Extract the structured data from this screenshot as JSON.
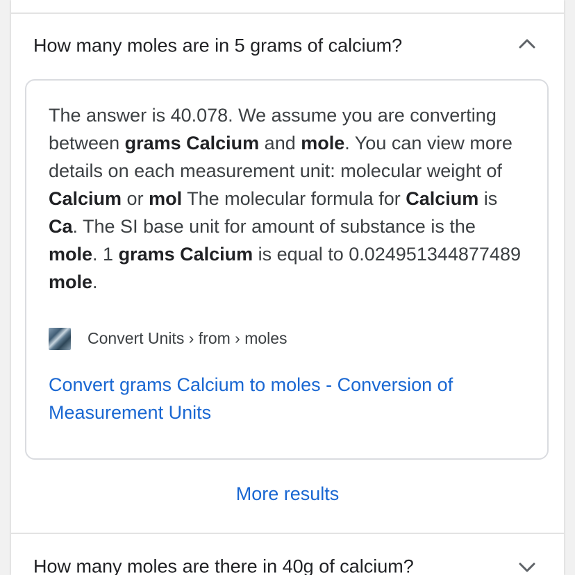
{
  "faq": {
    "expanded_item": {
      "question": "How many moles are in 5 grams of calcium?",
      "toggle_icon": "chevron-up-icon",
      "answer": {
        "segments": [
          {
            "t": "The answer is 40.078. We assume you are converting between ",
            "b": false
          },
          {
            "t": "grams Calcium",
            "b": true
          },
          {
            "t": " and ",
            "b": false
          },
          {
            "t": "mole",
            "b": true
          },
          {
            "t": ". You can view more details on each measurement unit: molecular weight of ",
            "b": false
          },
          {
            "t": "Calcium",
            "b": true
          },
          {
            "t": " or ",
            "b": false
          },
          {
            "t": "mol",
            "b": true
          },
          {
            "t": " The molecular formula for ",
            "b": false
          },
          {
            "t": "Calcium",
            "b": true
          },
          {
            "t": " is ",
            "b": false
          },
          {
            "t": "Ca",
            "b": true
          },
          {
            "t": ". The SI base unit for amount of substance is the ",
            "b": false
          },
          {
            "t": "mole",
            "b": true
          },
          {
            "t": ". 1 ",
            "b": false
          },
          {
            "t": "grams Calcium",
            "b": true
          },
          {
            "t": " is equal to 0.024951344877489 ",
            "b": false
          },
          {
            "t": "mole",
            "b": true
          },
          {
            "t": ".",
            "b": false
          }
        ]
      },
      "source": {
        "favicon_icon": "site-favicon",
        "breadcrumb": "Convert Units › from › moles"
      },
      "result_link": "Convert grams Calcium to moles - Conversion of Measurement Units",
      "more_results": "More results"
    },
    "next_item": {
      "question": "How many moles are there in 40g of calcium?",
      "toggle_icon": "chevron-down-icon"
    }
  }
}
